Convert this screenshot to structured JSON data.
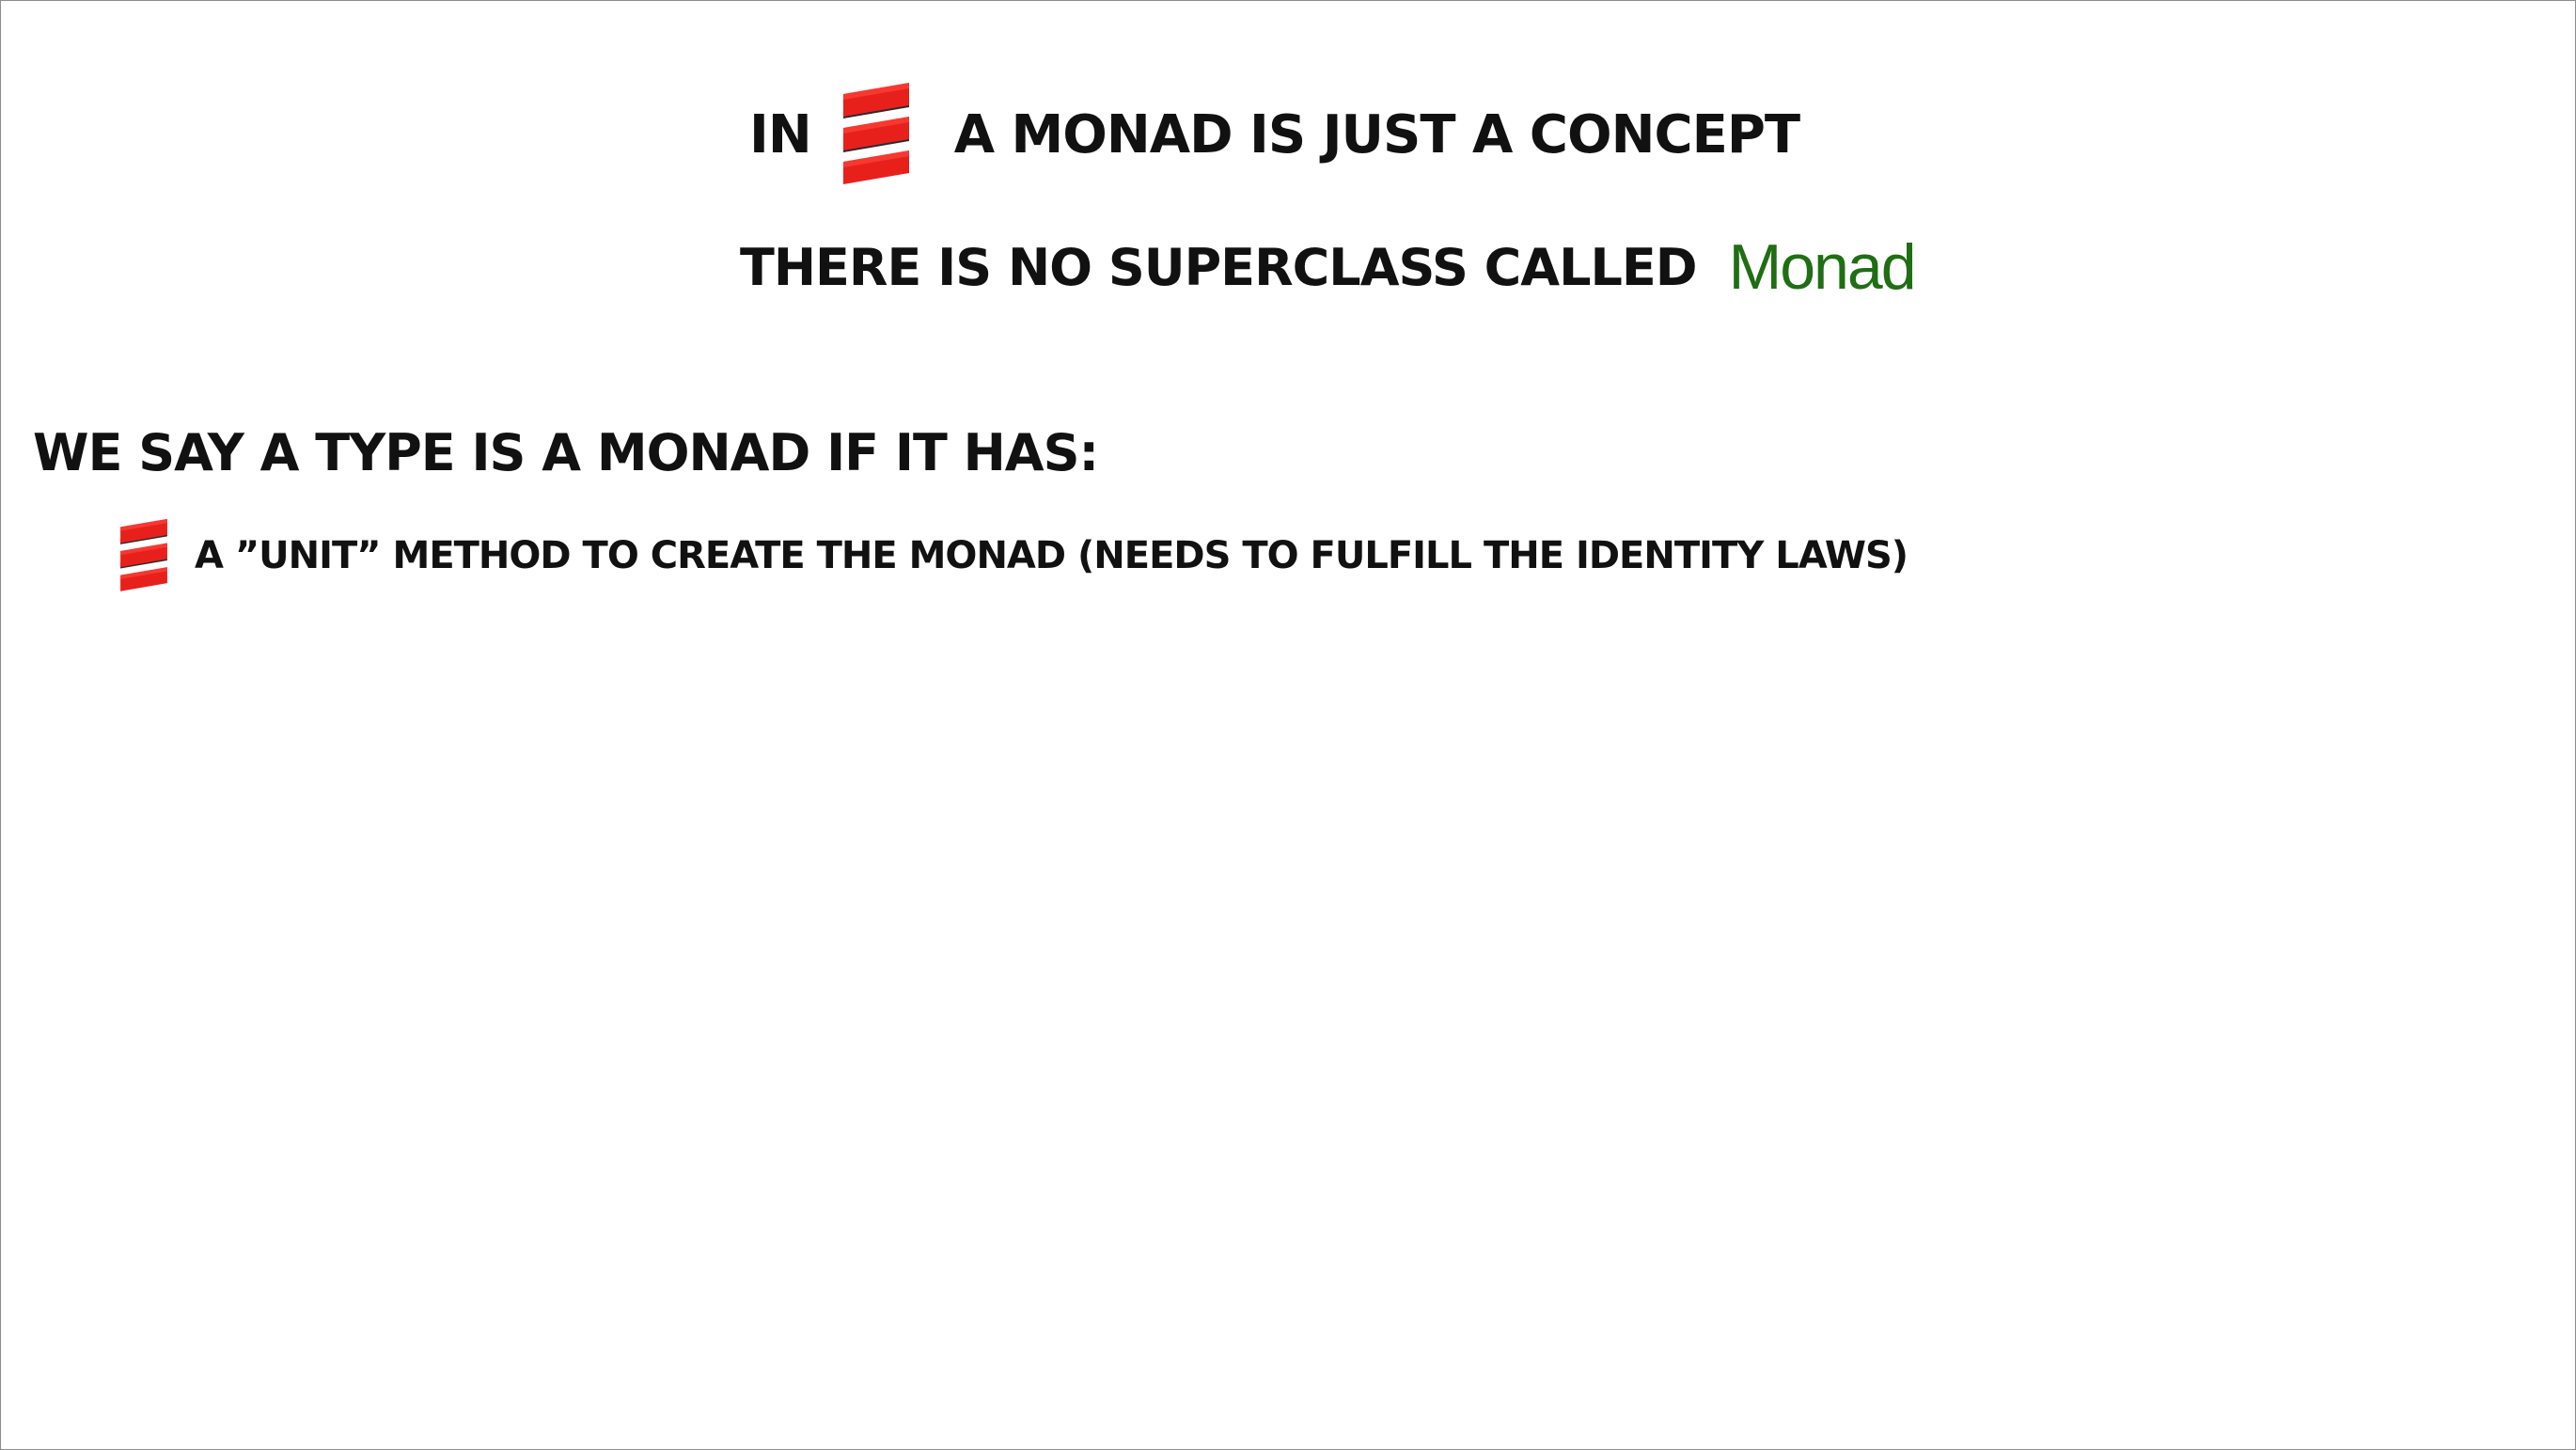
{
  "slide": {
    "line1": {
      "prefix": "IN",
      "logo_icon": "scala-logo-icon",
      "suffix": "A MONAD IS JUST A CONCEPT"
    },
    "line2": {
      "text": "THERE IS NO SUPERCLASS CALLED",
      "code": "Monad",
      "code_color": "#1f6e14"
    },
    "heading": "WE SAY A TYPE IS A MONAD IF IT HAS:",
    "bullets": [
      {
        "icon": "scala-logo-icon",
        "text": "A ”UNIT” METHOD TO CREATE THE MONAD (NEEDS TO FULFILL THE IDENTITY LAWS)"
      }
    ],
    "colors": {
      "scala_red": "#e8201c",
      "scala_dark": "#2a2a2a",
      "text": "#111111"
    }
  }
}
